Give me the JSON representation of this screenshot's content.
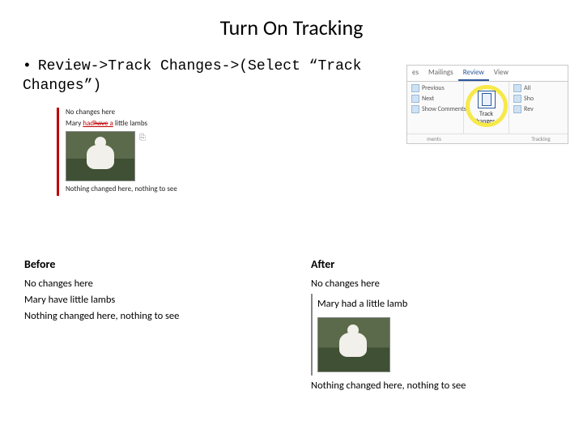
{
  "title": "Turn On Tracking",
  "bullet": "Review->Track Changes->(Select “Track Changes”)",
  "ribbon": {
    "tabs": [
      "es",
      "Mailings",
      "Review",
      "View"
    ],
    "active_tab": "Review",
    "left_items": [
      "Previous",
      "Next",
      "Show Comments"
    ],
    "track_label_line1": "Track",
    "track_label_line2": "Changes",
    "right_items": [
      "All",
      "Sho",
      "Rev"
    ],
    "footer": [
      "ments",
      "",
      "Tracking"
    ]
  },
  "revision_mock": {
    "line1": "No changes here",
    "line2_prefix": "Mary ",
    "line2_ins": "had",
    "line2_del": "have",
    "line2_suffix_ins": " a",
    "line2_tail": " little lambs",
    "line3": "Nothing changed here, nothing to see"
  },
  "before": {
    "heading": "Before",
    "l1": "No changes here",
    "l2": "Mary have little lambs",
    "l3": "Nothing changed here, nothing to see"
  },
  "after": {
    "heading": "After",
    "l1": "No changes here",
    "l2": "Mary had a little lamb",
    "l3": "Nothing changed here, nothing to see"
  }
}
